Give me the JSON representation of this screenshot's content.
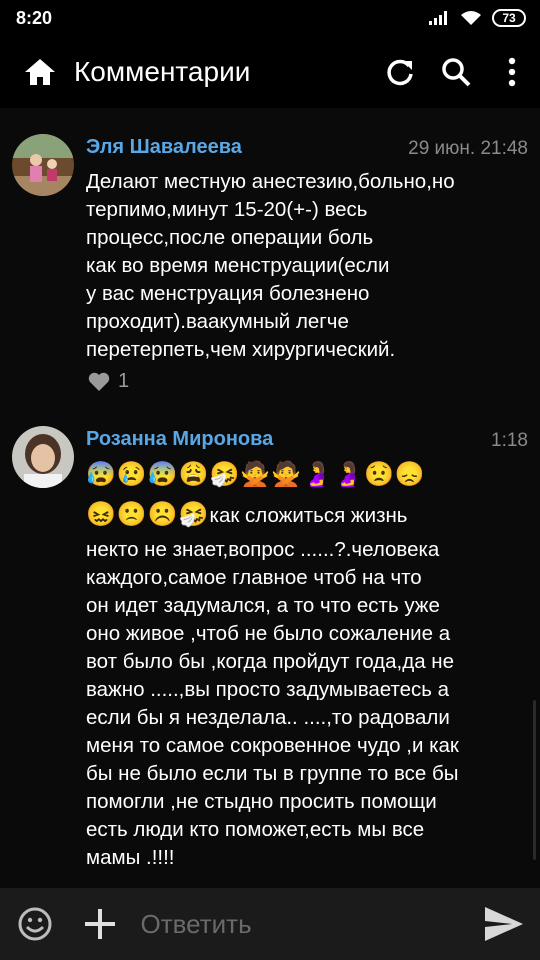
{
  "status_bar": {
    "time": "8:20",
    "battery": "73"
  },
  "app_bar": {
    "title": "Комментарии",
    "icons": [
      "home-icon",
      "refresh-icon",
      "search-icon",
      "more-vert-icon"
    ]
  },
  "comments": [
    {
      "author": "Эля Шавалеева",
      "time": "29 июн. 21:48",
      "text": "Делают местную анестезию,больно,но\nтерпимо,минут 15-20(+-) весь\nпроцесс,после операции боль\nкак во время менструации(если\nу вас менструация болезнено\nпроходит).ваакумный легче\nперетерпеть,чем хирургический.",
      "likes": "1"
    },
    {
      "author": "Розанна Миронова",
      "time": "1:18",
      "emoji_line1": "😰😢😰😩🤧🙅🙅🤰🤰😟😞",
      "emoji_line2": "😖🙁☹️🤧",
      "text_first": "как сложиться жизнь",
      "text": "некто не знает,вопрос ......?.человека\nкаждого,самое главное чтоб на что\nон идет задумался, а то что есть  уже\nоно живое  ,чтоб не было сожаление а\nвот было бы ,когда пройдут года,да не\nважно .....,вы просто задумываетесь а\nесли бы я незделала.. ....,то радовали\nменя то самое сокровенное чудо ,и как\nбы не было если ты в группе то все бы\nпомогли ,не стыдно просить помощи\nесть люди кто поможет,есть мы все\nмамы .!!!!"
    }
  ],
  "input_bar": {
    "placeholder": "Ответить"
  },
  "colors": {
    "accent": "#5aa7e6",
    "background": "#0a0a0a",
    "input_bar": "#1b1b1b"
  }
}
